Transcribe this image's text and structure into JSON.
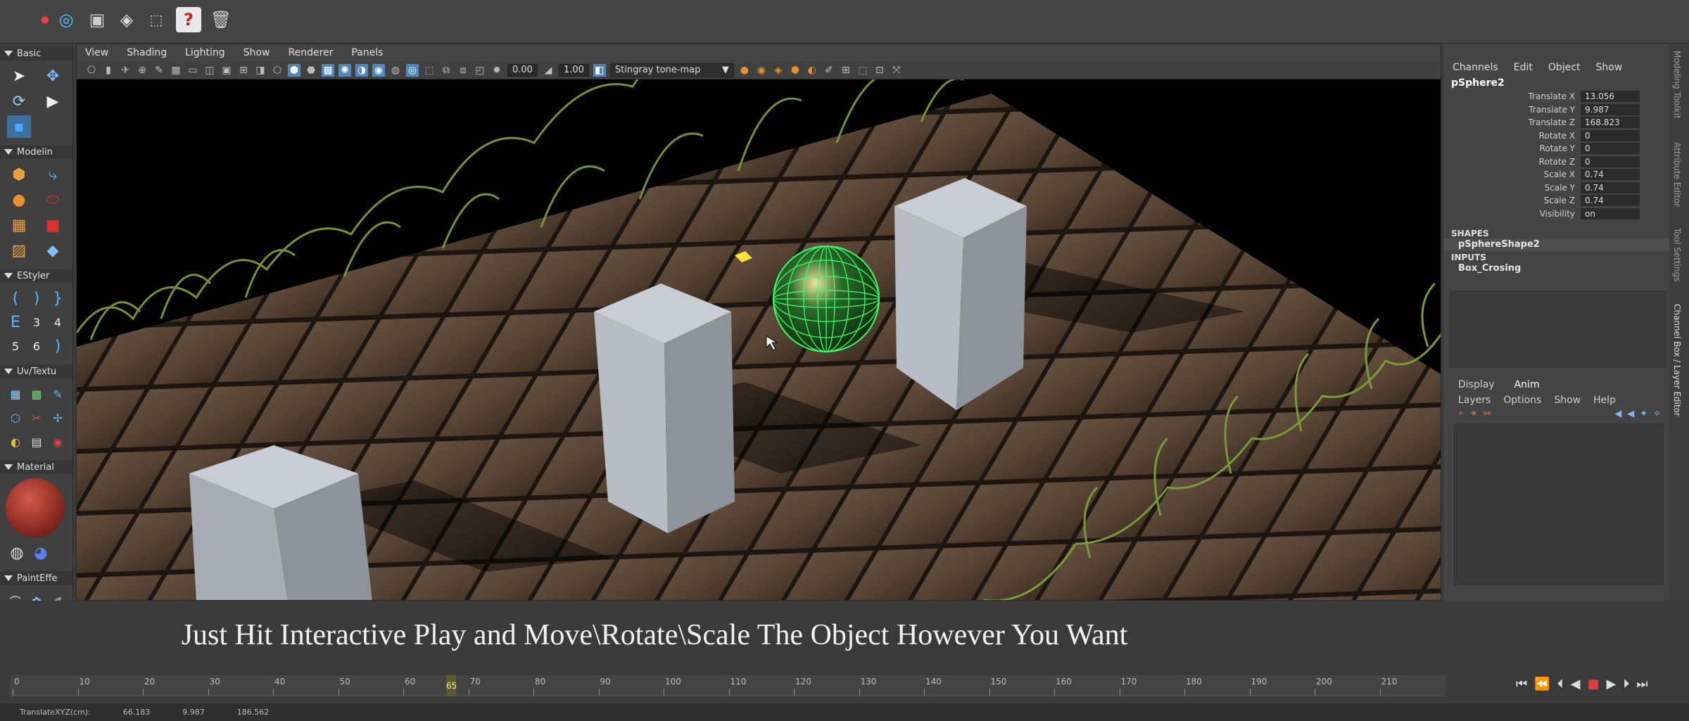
{
  "viewport_menu": [
    "View",
    "Shading",
    "Lighting",
    "Show",
    "Renderer",
    "Panels"
  ],
  "viewport_toolbar": {
    "exposure": "0.00",
    "gamma": "1.00",
    "tonemap": "Stingray tone-map"
  },
  "toolbox": {
    "sections": [
      "Basic",
      "Modelin",
      "EStyler",
      "Uv/Textu",
      "Material",
      "PaintEffe"
    ]
  },
  "channel_box": {
    "menu": [
      "Channels",
      "Edit",
      "Object",
      "Show"
    ],
    "node_name": "pSphere2",
    "attributes": [
      {
        "label": "Translate X",
        "value": "13.056"
      },
      {
        "label": "Translate Y",
        "value": "9.987"
      },
      {
        "label": "Translate Z",
        "value": "168.823"
      },
      {
        "label": "Rotate X",
        "value": "0"
      },
      {
        "label": "Rotate Y",
        "value": "0"
      },
      {
        "label": "Rotate Z",
        "value": "0"
      },
      {
        "label": "Scale X",
        "value": "0.74"
      },
      {
        "label": "Scale Y",
        "value": "0.74"
      },
      {
        "label": "Scale Z",
        "value": "0.74"
      },
      {
        "label": "Visibility",
        "value": "on"
      }
    ],
    "shapes_header": "SHAPES",
    "shape_item": "pSphereShape2",
    "inputs_header": "INPUTS",
    "input_item": "Box_Crosing"
  },
  "layer_editor": {
    "tabs": [
      "Display",
      "Anim"
    ],
    "menu": [
      "Layers",
      "Options",
      "Show",
      "Help"
    ]
  },
  "side_tabs": [
    "Modeling Toolkit",
    "Attribute Editor",
    "Tool Settings",
    "Channel Box / Layer Editor"
  ],
  "caption": "Just Hit Interactive Play and Move\\Rotate\\Scale The Object However You Want",
  "timeline": {
    "ticks": [
      "0",
      "10",
      "20",
      "30",
      "40",
      "50",
      "60",
      "70",
      "80",
      "90",
      "100",
      "110",
      "120",
      "130",
      "140",
      "150",
      "160",
      "170",
      "180",
      "190",
      "200",
      "210"
    ],
    "current_frame": "65"
  },
  "status_bar": {
    "label": "TranslateXYZ(cm):",
    "x": "66.183",
    "y": "9.987",
    "z": "186.562"
  }
}
